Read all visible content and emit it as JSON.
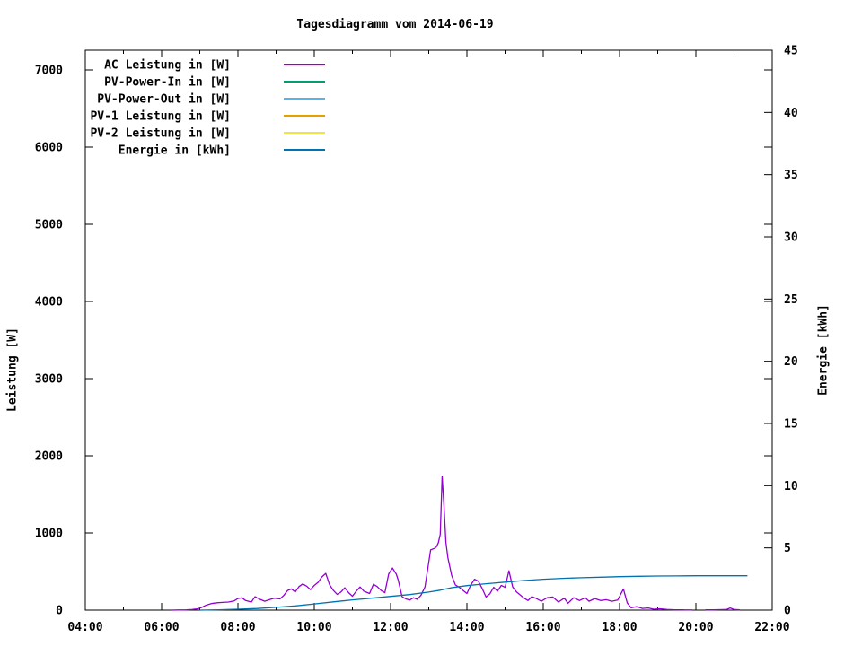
{
  "chart_data": {
    "type": "line",
    "title": "Tagesdiagramm vom 2014-06-19",
    "background": "#ffffff",
    "text_color": "#000000",
    "grid": false,
    "legend_position": "top-left-inside",
    "x_axis": {
      "range_hours": [
        4,
        22
      ],
      "major_ticks": [
        {
          "hour": 4,
          "label": "04:00"
        },
        {
          "hour": 6,
          "label": "06:00"
        },
        {
          "hour": 8,
          "label": "08:00"
        },
        {
          "hour": 10,
          "label": "10:00"
        },
        {
          "hour": 12,
          "label": "12:00"
        },
        {
          "hour": 14,
          "label": "14:00"
        },
        {
          "hour": 16,
          "label": "16:00"
        },
        {
          "hour": 18,
          "label": "18:00"
        },
        {
          "hour": 20,
          "label": "20:00"
        },
        {
          "hour": 22,
          "label": "22:00"
        }
      ],
      "minor_tick_hours": [
        5,
        7,
        9,
        11,
        13,
        15,
        17,
        19,
        21
      ]
    },
    "y_left": {
      "label": "Leistung [W]",
      "range": [
        0,
        7250
      ],
      "ticks": [
        0,
        1000,
        2000,
        3000,
        4000,
        5000,
        6000,
        7000
      ]
    },
    "y_right": {
      "label": "Energie [kWh]",
      "range": [
        0,
        45
      ],
      "ticks": [
        0,
        5,
        10,
        15,
        20,
        25,
        30,
        35,
        40,
        45
      ]
    },
    "series": [
      {
        "id": "ac-leistung",
        "name": "AC Leistung in [W]",
        "color": "#9400D3",
        "axis": "left",
        "segments": [
          [
            [
              6.25,
              0
            ],
            [
              6.45,
              2
            ],
            [
              6.65,
              4
            ],
            [
              6.8,
              8
            ],
            [
              6.95,
              18
            ],
            [
              7.05,
              35
            ],
            [
              7.15,
              60
            ],
            [
              7.3,
              85
            ],
            [
              7.45,
              95
            ],
            [
              7.6,
              100
            ],
            [
              7.75,
              105
            ],
            [
              7.9,
              120
            ],
            [
              8.0,
              150
            ],
            [
              8.1,
              160
            ],
            [
              8.2,
              125
            ],
            [
              8.35,
              105
            ],
            [
              8.45,
              175
            ],
            [
              8.55,
              145
            ],
            [
              8.7,
              115
            ],
            [
              8.85,
              140
            ],
            [
              8.95,
              155
            ],
            [
              9.1,
              145
            ],
            [
              9.2,
              190
            ],
            [
              9.3,
              255
            ],
            [
              9.4,
              275
            ],
            [
              9.5,
              235
            ],
            [
              9.6,
              305
            ],
            [
              9.7,
              340
            ],
            [
              9.8,
              310
            ],
            [
              9.9,
              265
            ],
            [
              10.0,
              320
            ],
            [
              10.1,
              360
            ],
            [
              10.2,
              430
            ],
            [
              10.3,
              475
            ],
            [
              10.4,
              330
            ],
            [
              10.5,
              255
            ],
            [
              10.6,
              205
            ],
            [
              10.7,
              235
            ],
            [
              10.8,
              290
            ],
            [
              10.9,
              225
            ],
            [
              11.0,
              180
            ],
            [
              11.1,
              245
            ],
            [
              11.2,
              300
            ],
            [
              11.3,
              245
            ],
            [
              11.45,
              215
            ],
            [
              11.55,
              335
            ],
            [
              11.65,
              305
            ],
            [
              11.75,
              255
            ],
            [
              11.85,
              225
            ],
            [
              11.95,
              470
            ],
            [
              12.05,
              545
            ],
            [
              12.15,
              465
            ],
            [
              12.2,
              390
            ],
            [
              12.3,
              175
            ],
            [
              12.4,
              145
            ],
            [
              12.5,
              130
            ],
            [
              12.6,
              160
            ],
            [
              12.7,
              140
            ],
            [
              12.8,
              195
            ],
            [
              12.9,
              300
            ],
            [
              13.0,
              620
            ],
            [
              13.05,
              780
            ],
            [
              13.15,
              800
            ],
            [
              13.2,
              820
            ],
            [
              13.25,
              870
            ],
            [
              13.3,
              980
            ],
            [
              13.35,
              1735
            ],
            [
              13.4,
              1340
            ],
            [
              13.45,
              880
            ],
            [
              13.5,
              680
            ],
            [
              13.6,
              450
            ],
            [
              13.7,
              325
            ],
            [
              13.8,
              295
            ],
            [
              13.9,
              255
            ],
            [
              14.0,
              215
            ],
            [
              14.1,
              325
            ],
            [
              14.2,
              400
            ],
            [
              14.3,
              375
            ],
            [
              14.4,
              280
            ],
            [
              14.5,
              170
            ],
            [
              14.6,
              210
            ],
            [
              14.7,
              295
            ],
            [
              14.8,
              245
            ],
            [
              14.9,
              320
            ],
            [
              15.0,
              295
            ],
            [
              15.1,
              510
            ],
            [
              15.2,
              300
            ],
            [
              15.3,
              235
            ],
            [
              15.4,
              195
            ],
            [
              15.5,
              155
            ],
            [
              15.6,
              125
            ],
            [
              15.7,
              175
            ],
            [
              15.8,
              155
            ],
            [
              15.95,
              115
            ],
            [
              16.1,
              160
            ],
            [
              16.25,
              170
            ],
            [
              16.4,
              105
            ],
            [
              16.55,
              155
            ],
            [
              16.65,
              90
            ],
            [
              16.8,
              160
            ],
            [
              16.95,
              125
            ],
            [
              17.1,
              160
            ],
            [
              17.2,
              115
            ],
            [
              17.35,
              150
            ],
            [
              17.5,
              125
            ],
            [
              17.65,
              135
            ],
            [
              17.8,
              115
            ],
            [
              17.95,
              130
            ],
            [
              18.1,
              275
            ],
            [
              18.2,
              95
            ],
            [
              18.3,
              30
            ],
            [
              18.45,
              45
            ],
            [
              18.6,
              22
            ],
            [
              18.75,
              28
            ],
            [
              18.9,
              12
            ],
            [
              19.05,
              18
            ],
            [
              19.25,
              8
            ],
            [
              19.45,
              5
            ],
            [
              19.65,
              3
            ],
            [
              19.9,
              2
            ]
          ],
          [
            [
              20.25,
              4
            ],
            [
              20.45,
              4
            ],
            [
              20.6,
              6
            ],
            [
              20.8,
              8
            ],
            [
              20.9,
              28
            ],
            [
              21.0,
              8
            ],
            [
              21.15,
              4
            ]
          ]
        ]
      },
      {
        "id": "pv-power-in",
        "name": "PV-Power-In in [W]",
        "color": "#009E73",
        "axis": "left",
        "segments": []
      },
      {
        "id": "pv-power-out",
        "name": "PV-Power-Out in [W]",
        "color": "#56B4E9",
        "axis": "left",
        "segments": []
      },
      {
        "id": "pv-1-leistung",
        "name": "PV-1 Leistung in [W]",
        "color": "#E69F00",
        "axis": "left",
        "segments": []
      },
      {
        "id": "pv-2-leistung",
        "name": "PV-2 Leistung in [W]",
        "color": "#F0E442",
        "axis": "left",
        "segments": []
      },
      {
        "id": "energie",
        "name": "Energie in [kWh]",
        "color": "#0072B2",
        "axis": "right",
        "segments": [
          [
            [
              7.0,
              0.0
            ],
            [
              7.5,
              0.03
            ],
            [
              8.0,
              0.07
            ],
            [
              8.5,
              0.13
            ],
            [
              9.0,
              0.22
            ],
            [
              9.5,
              0.34
            ],
            [
              10.0,
              0.5
            ],
            [
              10.5,
              0.66
            ],
            [
              11.0,
              0.82
            ],
            [
              11.5,
              0.96
            ],
            [
              12.0,
              1.1
            ],
            [
              12.5,
              1.25
            ],
            [
              13.0,
              1.45
            ],
            [
              13.3,
              1.6
            ],
            [
              13.6,
              1.8
            ],
            [
              14.0,
              1.97
            ],
            [
              14.5,
              2.12
            ],
            [
              15.0,
              2.25
            ],
            [
              15.5,
              2.38
            ],
            [
              16.0,
              2.48
            ],
            [
              16.5,
              2.55
            ],
            [
              17.0,
              2.6
            ],
            [
              17.5,
              2.65
            ],
            [
              18.0,
              2.69
            ],
            [
              18.5,
              2.72
            ],
            [
              19.0,
              2.74
            ],
            [
              19.5,
              2.75
            ],
            [
              20.0,
              2.76
            ],
            [
              20.5,
              2.76
            ],
            [
              21.0,
              2.76
            ],
            [
              21.35,
              2.76
            ]
          ]
        ]
      }
    ]
  }
}
